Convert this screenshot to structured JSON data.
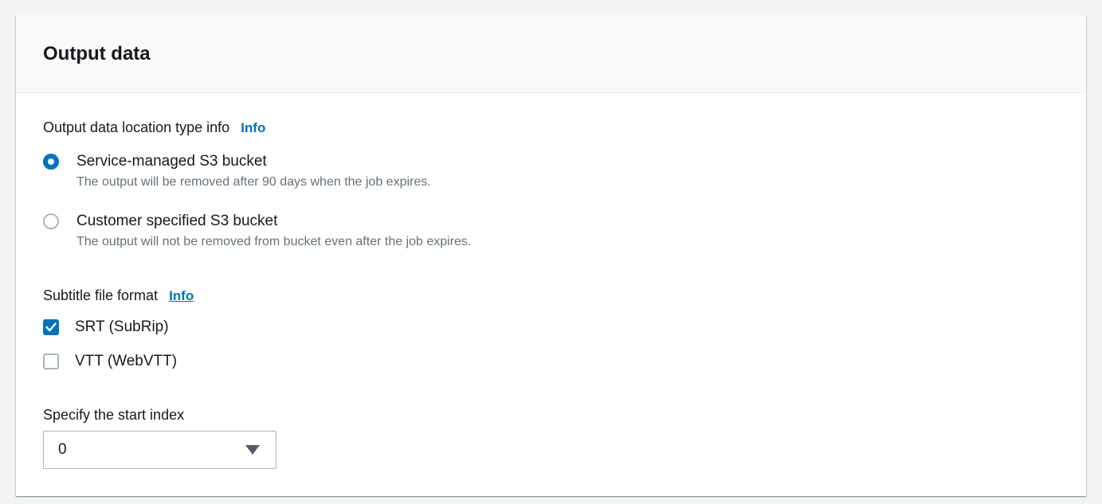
{
  "panel": {
    "title": "Output data"
  },
  "location": {
    "label": "Output data location type info",
    "info_link": "Info",
    "options": [
      {
        "label": "Service-managed S3 bucket",
        "description": "The output will be removed after 90 days when the job expires.",
        "selected": true
      },
      {
        "label": "Customer specified S3 bucket",
        "description": "The output will not be removed from bucket even after the job expires.",
        "selected": false
      }
    ]
  },
  "subtitle_format": {
    "label": "Subtitle file format",
    "info_link": "Info",
    "options": [
      {
        "label": "SRT (SubRip)",
        "checked": true
      },
      {
        "label": "VTT (WebVTT)",
        "checked": false
      }
    ]
  },
  "start_index": {
    "label": "Specify the start index",
    "value": "0"
  },
  "colors": {
    "accent": "#0073bb",
    "text": "#16191f",
    "secondary_text": "#687078",
    "border": "#aab7b8"
  }
}
